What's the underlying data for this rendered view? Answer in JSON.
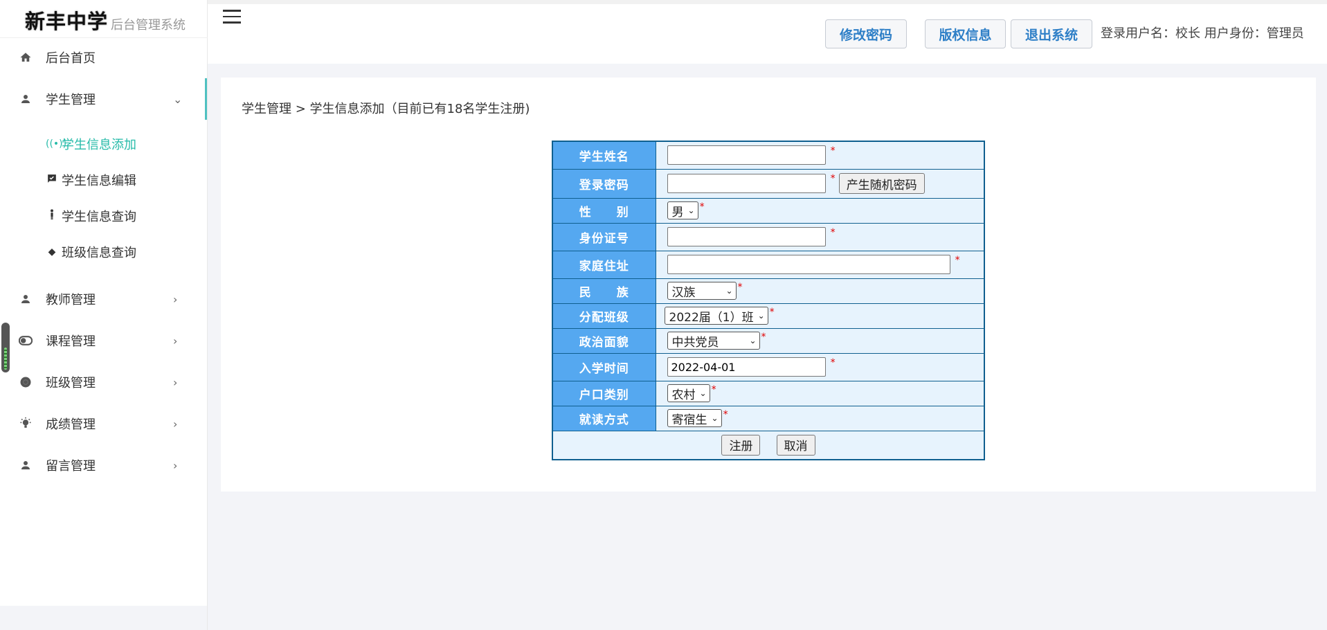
{
  "brand": {
    "title": "新丰中学",
    "subtitle": "后台管理系统"
  },
  "sidebar": {
    "home": {
      "label": "后台首页",
      "icon": "home-icon"
    },
    "student": {
      "label": "学生管理",
      "icon": "user-icon",
      "expanded": true,
      "children": [
        {
          "label": "学生信息添加",
          "icon": "broadcast-icon",
          "active": true
        },
        {
          "label": "学生信息编辑",
          "icon": "check-message-icon"
        },
        {
          "label": "学生信息查询",
          "icon": "person-icon"
        },
        {
          "label": "班级信息查询",
          "icon": "diamond-icon"
        }
      ]
    },
    "groups": [
      {
        "label": "教师管理",
        "icon": "user-icon"
      },
      {
        "label": "课程管理",
        "icon": "toggle-icon"
      },
      {
        "label": "班级管理",
        "icon": "gear-icon"
      },
      {
        "label": "成绩管理",
        "icon": "lightbulb-icon"
      },
      {
        "label": "留言管理",
        "icon": "user-icon"
      }
    ]
  },
  "header": {
    "buttons": {
      "change_password": "修改密码",
      "copyright": "版权信息",
      "logout": "退出系统"
    },
    "user_info": "登录用户名：校长 用户身份：管理员"
  },
  "breadcrumb": "学生管理 > 学生信息添加（目前已有18名学生注册)",
  "form": {
    "labels": {
      "name": "学生姓名",
      "password": "登录密码",
      "gender": "性　　别",
      "id_number": "身份证号",
      "address": "家庭住址",
      "ethnicity": "民　　族",
      "class": "分配班级",
      "politics": "政治面貌",
      "enroll_date": "入学时间",
      "hukou": "户口类别",
      "study_mode": "就读方式"
    },
    "values": {
      "name": "",
      "password": "",
      "gender": "男",
      "id_number": "",
      "address": "",
      "ethnicity": "汉族",
      "class": "2022届（1）班",
      "politics": "中共党员",
      "enroll_date": "2022-04-01",
      "hukou": "农村",
      "study_mode": "寄宿生"
    },
    "required_mark": "*",
    "random_password_button": "产生随机密码",
    "submit_button": "注册",
    "cancel_button": "取消"
  },
  "colors": {
    "accent": "#27bba9",
    "label_bg": "#55a8f0",
    "field_bg": "#e7f3fd",
    "header_button_text": "#2e7fc7",
    "required": "#e10000"
  }
}
